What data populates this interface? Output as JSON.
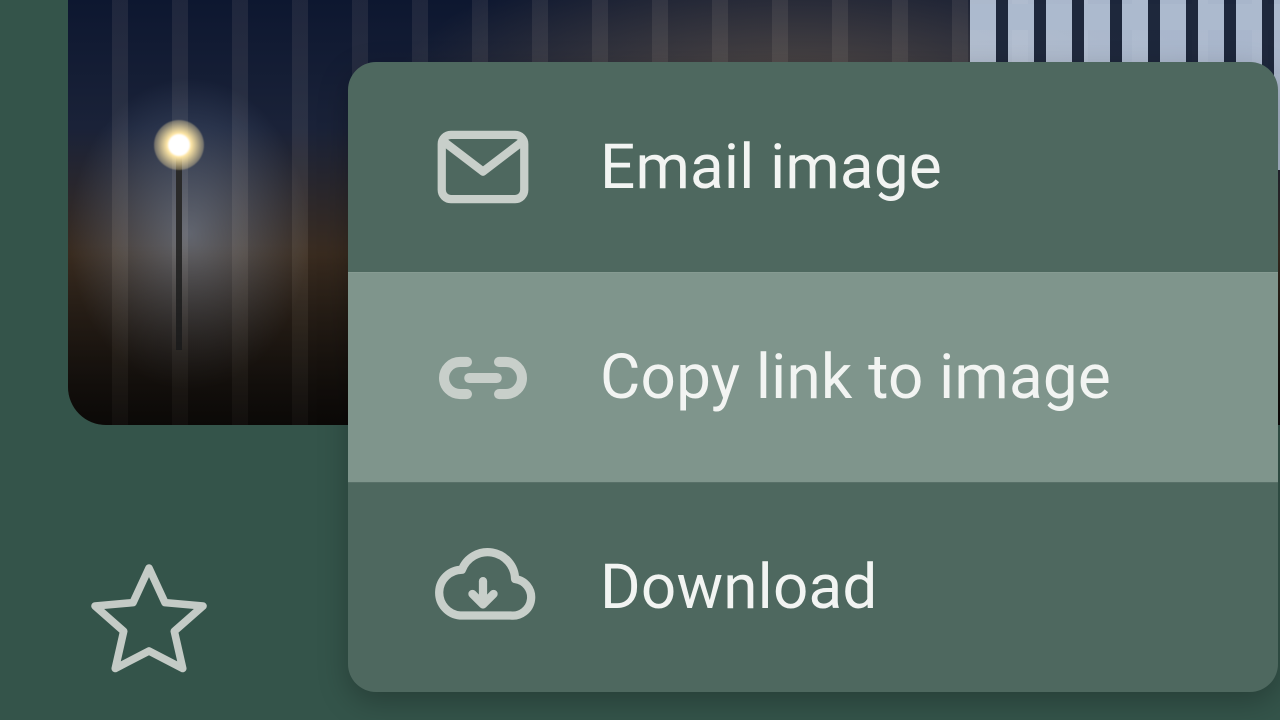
{
  "colors": {
    "bg": "#34544a",
    "menu": "#4e685f",
    "menu_hover": "#7f958c"
  },
  "menu": {
    "items": [
      {
        "label": "Email image",
        "icon": "mail-icon",
        "hover": false
      },
      {
        "label": "Copy link to image",
        "icon": "link-icon",
        "hover": true
      },
      {
        "label": "Download",
        "icon": "cloud-download-icon",
        "hover": false
      }
    ]
  },
  "toolbar": {
    "star": "star-outline-icon"
  }
}
